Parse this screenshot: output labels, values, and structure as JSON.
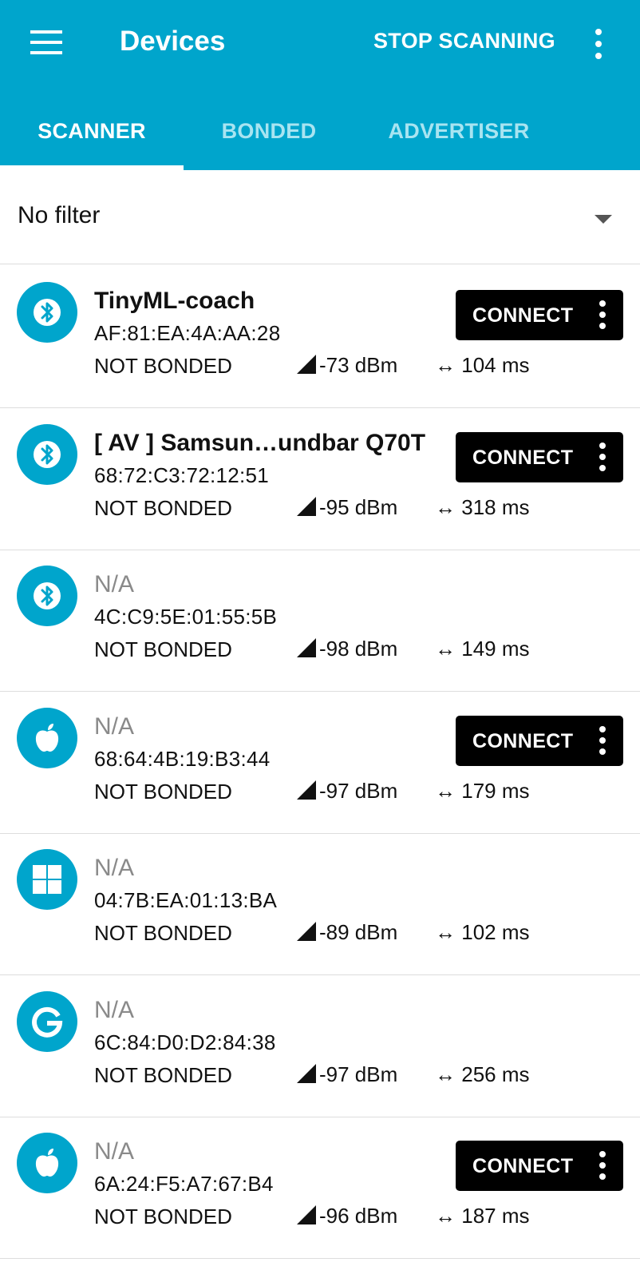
{
  "header": {
    "title": "Devices",
    "stop_label": "STOP SCANNING",
    "menu_icon": "hamburger-menu-icon",
    "overflow_icon": "more-vert-icon"
  },
  "tabs": [
    {
      "label": "SCANNER",
      "active": true
    },
    {
      "label": "BONDED",
      "active": false
    },
    {
      "label": "ADVERTISER",
      "active": false
    }
  ],
  "filter": {
    "label": "No filter"
  },
  "connect_label": "CONNECT",
  "devices": [
    {
      "name": "TinyML-coach",
      "address": "AF:81:EA:4A:AA:28",
      "bond": "NOT BONDED",
      "rssi": "-73 dBm",
      "interval": "104 ms",
      "icon": "bluetooth-icon",
      "connectable": true,
      "named": true
    },
    {
      "name": "[ AV ] Samsun…undbar Q70T",
      "address": "68:72:C3:72:12:51",
      "bond": "NOT BONDED",
      "rssi": "-95 dBm",
      "interval": "318 ms",
      "icon": "bluetooth-icon",
      "connectable": true,
      "named": true
    },
    {
      "name": "N/A",
      "address": "4C:C9:5E:01:55:5B",
      "bond": "NOT BONDED",
      "rssi": "-98 dBm",
      "interval": "149 ms",
      "icon": "bluetooth-icon",
      "connectable": false,
      "named": false
    },
    {
      "name": "N/A",
      "address": "68:64:4B:19:B3:44",
      "bond": "NOT BONDED",
      "rssi": "-97 dBm",
      "interval": "179 ms",
      "icon": "apple-icon",
      "connectable": true,
      "named": false
    },
    {
      "name": "N/A",
      "address": "04:7B:EA:01:13:BA",
      "bond": "NOT BONDED",
      "rssi": "-89 dBm",
      "interval": "102 ms",
      "icon": "windows-icon",
      "connectable": false,
      "named": false
    },
    {
      "name": "N/A",
      "address": "6C:84:D0:D2:84:38",
      "bond": "NOT BONDED",
      "rssi": "-97 dBm",
      "interval": "256 ms",
      "icon": "google-icon",
      "connectable": false,
      "named": false
    },
    {
      "name": "N/A",
      "address": "6A:24:F5:A7:67:B4",
      "bond": "NOT BONDED",
      "rssi": "-96 dBm",
      "interval": "187 ms",
      "icon": "apple-icon",
      "connectable": true,
      "named": false
    }
  ],
  "colors": {
    "primary": "#00a5cc",
    "inactive_tab": "#a8e4f1",
    "button": "#000000"
  }
}
